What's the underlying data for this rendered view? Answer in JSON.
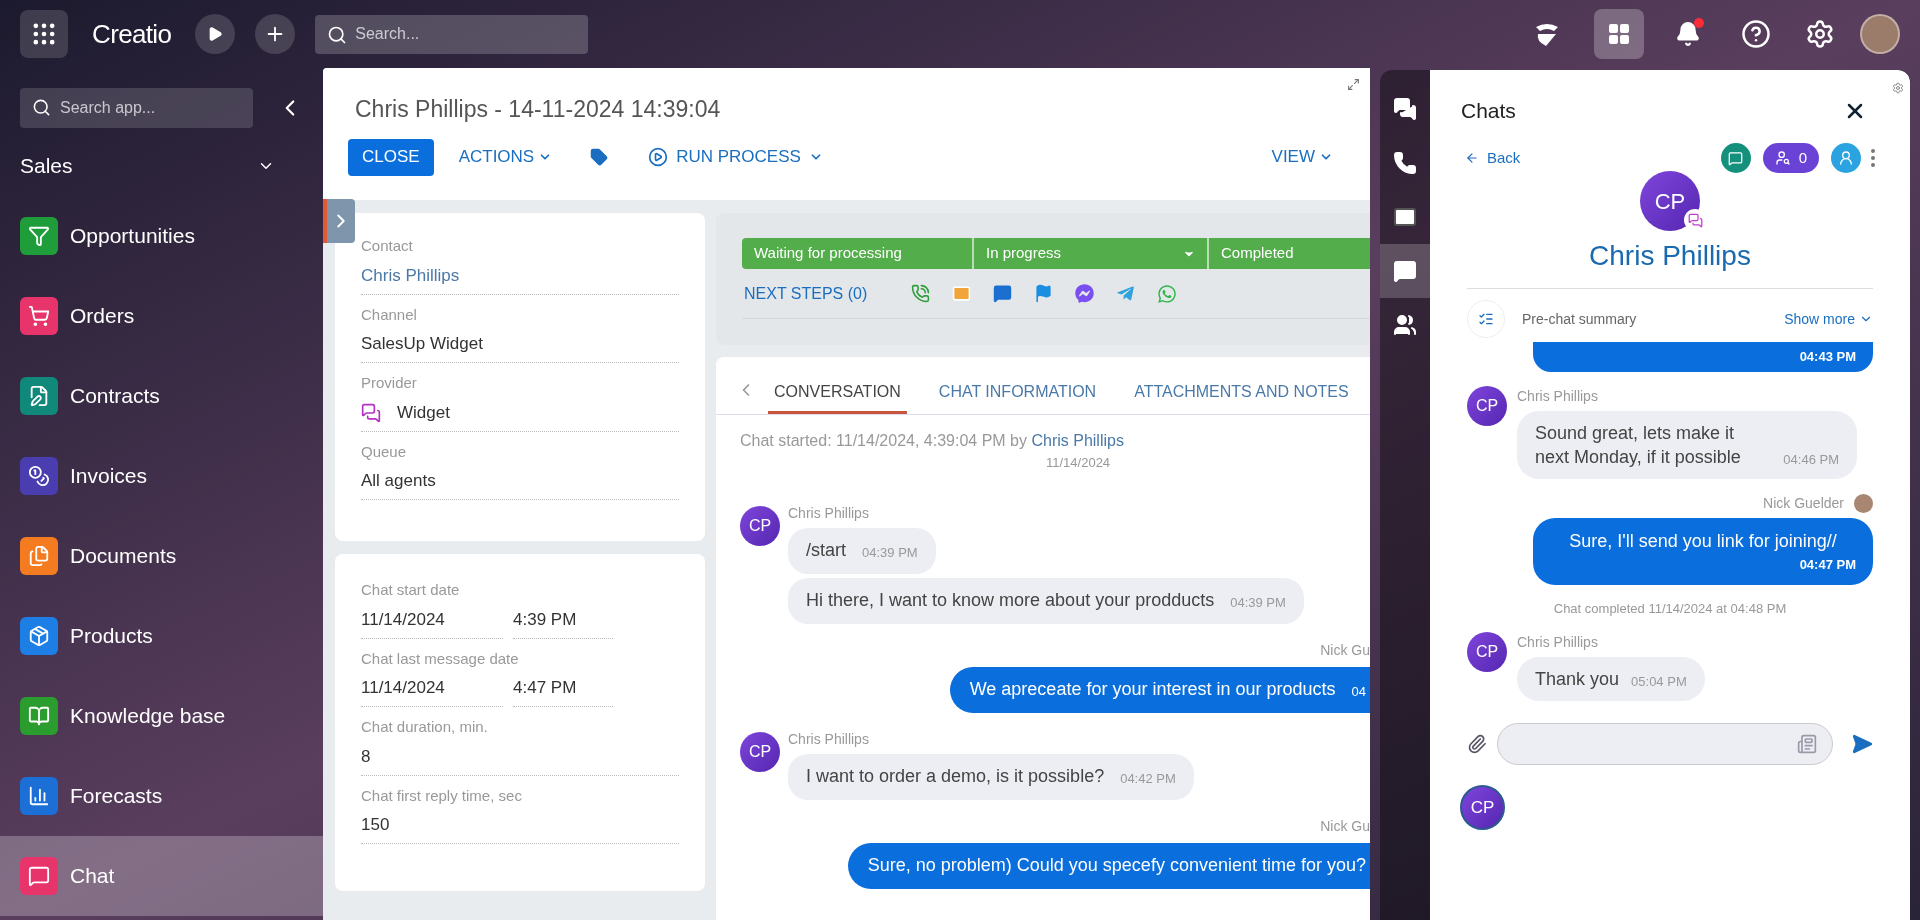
{
  "topbar": {
    "logo": "Creatio",
    "search_placeholder": "Search..."
  },
  "sidebar": {
    "search_placeholder": "Search app...",
    "section": "Sales",
    "items": [
      {
        "label": "Opportunities",
        "color": "#1f9d3a",
        "selected": false
      },
      {
        "label": "Orders",
        "color": "#e7356c",
        "selected": false
      },
      {
        "label": "Contracts",
        "color": "#10887a",
        "selected": false
      },
      {
        "label": "Invoices",
        "color": "#4a3db0",
        "selected": false
      },
      {
        "label": "Documents",
        "color": "#f47b20",
        "selected": false
      },
      {
        "label": "Products",
        "color": "#1d7ee6",
        "selected": false
      },
      {
        "label": "Knowledge base",
        "color": "#2b9d2f",
        "selected": false
      },
      {
        "label": "Forecasts",
        "color": "#1b6fd6",
        "selected": false
      },
      {
        "label": "Chat",
        "color": "#e7356c",
        "selected": true
      }
    ]
  },
  "record": {
    "title": "Chris Phillips - 14-11-2024 14:39:04",
    "buttons": {
      "close": "CLOSE",
      "actions": "ACTIONS",
      "run_process": "RUN PROCESS",
      "view": "VIEW"
    },
    "fields": [
      {
        "label": "Contact",
        "value": "Chris Phillips",
        "kind": "link"
      },
      {
        "label": "Channel",
        "value": "SalesUp Widget",
        "kind": "text"
      },
      {
        "label": "Provider",
        "value": "Widget",
        "kind": "provider"
      },
      {
        "label": "Queue",
        "value": "All agents",
        "kind": "text"
      }
    ],
    "details": [
      {
        "label": "Chat start date",
        "values": [
          "11/14/2024",
          "4:39 PM"
        ]
      },
      {
        "label": "Chat last message date",
        "values": [
          "11/14/2024",
          "4:47 PM"
        ]
      },
      {
        "label": "Chat duration, min.",
        "values": [
          "8"
        ]
      },
      {
        "label": "Chat first reply time, sec",
        "values": [
          "150"
        ]
      }
    ],
    "stages": [
      {
        "label": "Waiting for processing",
        "has_menu": false
      },
      {
        "label": "In progress",
        "has_menu": true
      },
      {
        "label": "Completed",
        "has_menu": false
      }
    ],
    "next_steps": "NEXT STEPS (0)",
    "tabs": [
      {
        "label": "CONVERSATION",
        "selected": true
      },
      {
        "label": "CHAT INFORMATION",
        "selected": false
      },
      {
        "label": "ATTACHMENTS AND NOTES",
        "selected": false
      }
    ],
    "conversation": {
      "started": "Chat started: 11/14/2024, 4:39:04 PM by",
      "started_by": "Chris Phillips",
      "date": "11/14/2024",
      "messages": [
        {
          "kind": "received",
          "author": "Chris Phillips",
          "avatar": "CP",
          "bubbles": [
            {
              "text": "/start",
              "time": "04:39 PM"
            },
            {
              "text": "Hi there, I want to know more about your prodducts",
              "time": "04:39 PM"
            }
          ]
        },
        {
          "kind": "sent",
          "author": "Nick Gu",
          "bubbles": [
            {
              "text": "We apreceate for your interest in our products",
              "time": "04"
            }
          ]
        },
        {
          "kind": "received",
          "author": "Chris Phillips",
          "avatar": "CP",
          "bubbles": [
            {
              "text": "I want to order a demo, is it possible?",
              "time": "04:42 PM"
            }
          ]
        },
        {
          "kind": "sent",
          "author": "Nick Gu",
          "bubbles": [
            {
              "text": "Sure, no problem) Could you specefy convenient time for you?"
            }
          ]
        }
      ]
    }
  },
  "chats": {
    "title": "Chats",
    "back": "Back",
    "participants": "0",
    "contact": {
      "initials": "CP",
      "name": "Chris Phillips"
    },
    "prechat": {
      "label": "Pre-chat summary",
      "show_more": "Show more"
    },
    "messages": [
      {
        "kind": "sent",
        "time": "04:43 PM"
      },
      {
        "kind": "received",
        "author": "Chris Phillips",
        "avatar": "CP",
        "text": "Sound great, lets make it next Monday, if it possible",
        "time": "04:46 PM"
      },
      {
        "kind": "sent",
        "author": "Nick Guelder",
        "text": "Sure, I'll send you link for joining//",
        "time": "04:47 PM"
      },
      {
        "kind": "system",
        "text": "Chat completed 11/14/2024 at 04:48 PM"
      },
      {
        "kind": "received",
        "author": "Chris Phillips",
        "avatar": "CP",
        "text": "Thank you",
        "time": "05:04 PM"
      }
    ],
    "footer_avatar": "CP"
  }
}
